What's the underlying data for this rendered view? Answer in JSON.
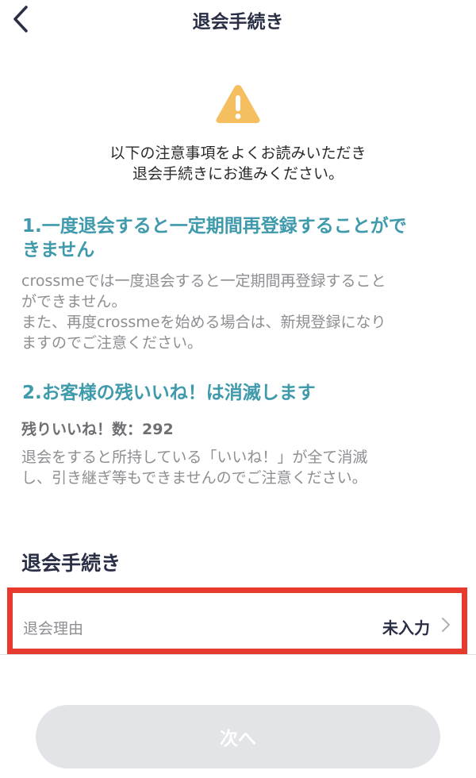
{
  "header": {
    "title": "退会手続き",
    "back_icon": "chevron-left-icon"
  },
  "warning": {
    "icon": "warning-triangle-icon",
    "color": "#f5bf5f",
    "intro_line1": "以下の注意事項をよくお読みいただき",
    "intro_line2": "退会手続きにお進みください。"
  },
  "notice1": {
    "heading_line1": "1.一度退会すると一定期間再登録することがで",
    "heading_line2": "きません",
    "body": "crossmeでは一度退会すると一定期間再登録すること\nができません。\nまた、再度crossmeを始める場合は、新規登録になり\nますのでご注意ください。"
  },
  "notice2": {
    "heading": "2.お客様の残いいね！は消滅します",
    "remaining_label": "残りいいね！数：292",
    "body": "退会をすると所持している「いいね！」が全て消滅\nし、引き継ぎ等もできませんのでご注意ください。"
  },
  "procedure": {
    "title": "退会手続き",
    "reason_label": "退会理由",
    "reason_value": "未入力"
  },
  "next_button": {
    "label": "次へ"
  },
  "colors": {
    "accent_teal": "#3f9aac",
    "highlight_red": "#e63a2e",
    "disabled_button": "#e3e4e8"
  }
}
